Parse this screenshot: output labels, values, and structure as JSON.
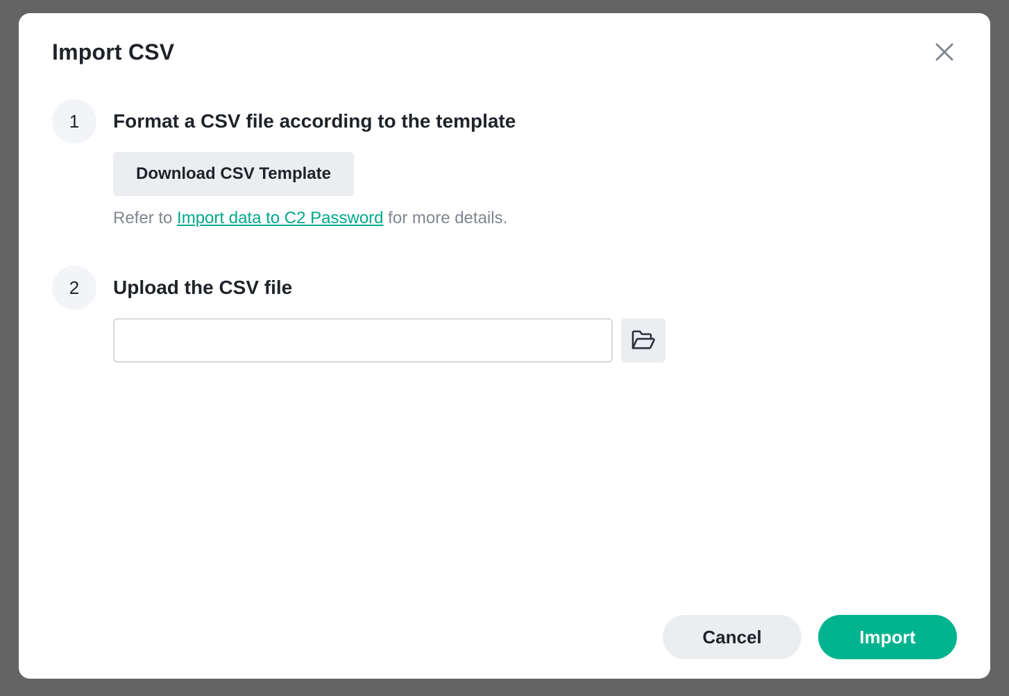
{
  "dialog": {
    "title": "Import CSV",
    "close_icon": "close-icon"
  },
  "step1": {
    "number": "1",
    "heading": "Format a CSV file according to the template",
    "download_label": "Download CSV Template",
    "help_prefix": "Refer to ",
    "help_link": "Import data to C2 Password",
    "help_suffix": " for more details."
  },
  "step2": {
    "number": "2",
    "heading": "Upload the CSV file",
    "file_value": "",
    "file_placeholder": "",
    "browse_icon": "folder-open-icon"
  },
  "footer": {
    "cancel_label": "Cancel",
    "import_label": "Import"
  },
  "colors": {
    "overlay": "#646464",
    "accent": "#00b38f",
    "link": "#00a88a",
    "text": "#1f2329",
    "muted": "#80868f",
    "button_gray": "#ebedf0"
  }
}
